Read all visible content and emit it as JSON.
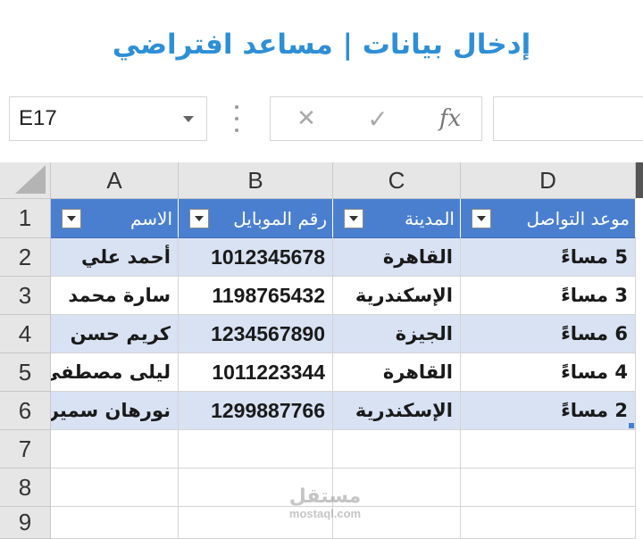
{
  "banner": {
    "title": "إدخال بيانات | مساعد افتراضي"
  },
  "name_box": {
    "value": "E17"
  },
  "formula_bar": {
    "fx_label": "fx",
    "cancel_glyph": "✕",
    "enter_glyph": "✓",
    "value": ""
  },
  "sheet": {
    "columns": [
      "A",
      "B",
      "C",
      "D"
    ],
    "rows": [
      "1",
      "2",
      "3",
      "4",
      "5",
      "6",
      "7",
      "8",
      "9"
    ],
    "headers": {
      "A": "الاسم",
      "B": "رقم الموبايل",
      "C": "المدينة",
      "D": "موعد التواصل"
    },
    "records": [
      {
        "name": "أحمد علي",
        "mobile": "1012345678",
        "city": "القاهرة",
        "time": "5 مساءً"
      },
      {
        "name": "سارة محمد",
        "mobile": "1198765432",
        "city": "الإسكندرية",
        "time": "3 مساءً"
      },
      {
        "name": "كريم حسن",
        "mobile": "1234567890",
        "city": "الجيزة",
        "time": "6 مساءً"
      },
      {
        "name": "ليلى مصطفى",
        "mobile": "1011223344",
        "city": "القاهرة",
        "time": "4 مساءً"
      },
      {
        "name": "نورهان سمير",
        "mobile": "1299887766",
        "city": "الإسكندرية",
        "time": "2 مساءً"
      }
    ]
  },
  "watermark": {
    "arabic": "مستقل",
    "latin": "mostaql.com"
  },
  "colors": {
    "accent": "#2e8fd6",
    "table_header": "#4a7fd0",
    "band": "#d8e2f3"
  }
}
